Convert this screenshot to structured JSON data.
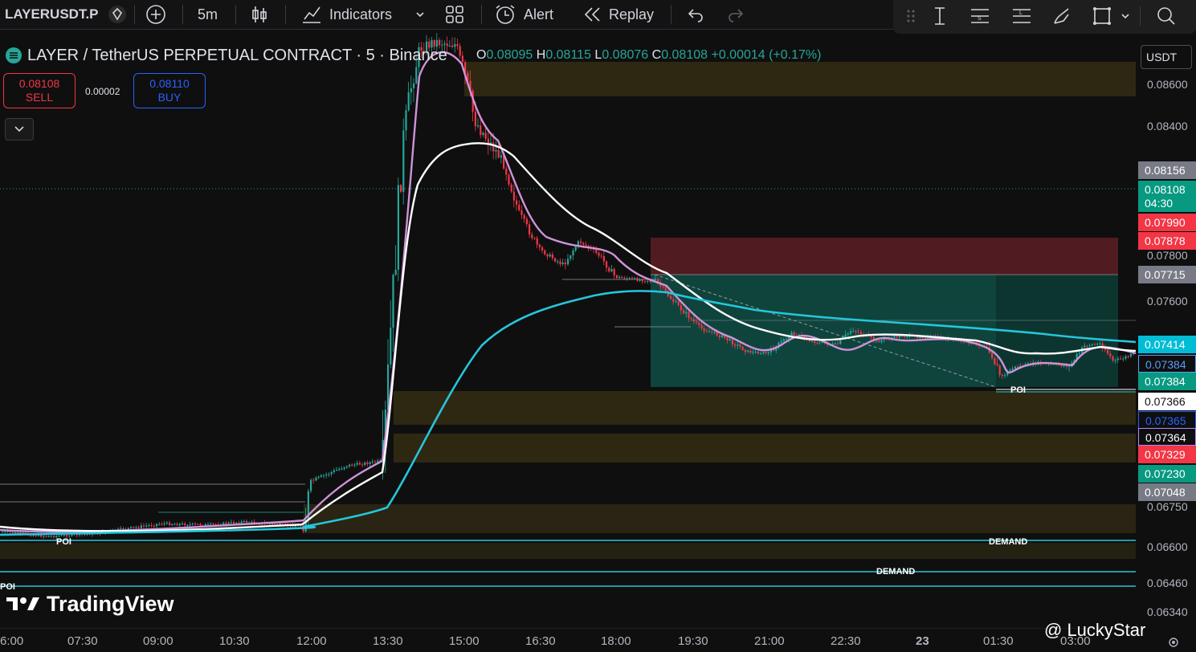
{
  "toolbar": {
    "symbol": "LAYERUSDT.P",
    "interval": "5m",
    "indicators_label": "Indicators",
    "alert_label": "Alert",
    "replay_label": "Replay"
  },
  "legend": {
    "title": "LAYER / TetherUS PERPETUAL CONTRACT · 5 · Binance",
    "open_label": "O",
    "open": "0.08095",
    "high_label": "H",
    "high": "0.08115",
    "low_label": "L",
    "low": "0.08076",
    "close_label": "C",
    "close": "0.08108",
    "change": "+0.00014 (+0.17%)"
  },
  "trade": {
    "sell_price": "0.08108",
    "sell_label": "SELL",
    "spread": "0.00002",
    "buy_price": "0.08110",
    "buy_label": "BUY"
  },
  "price_axis": {
    "currency": "USDT",
    "ticks": [
      "0.08600",
      "0.08400",
      "0.07800",
      "0.07600",
      "0.06750",
      "0.06600",
      "0.06460",
      "0.06340"
    ],
    "labels": [
      {
        "text": "0.08156",
        "bg": "#787b86"
      },
      {
        "text": "0.08108",
        "bg": "#089981"
      },
      {
        "text": "04:30",
        "bg": "#089981"
      },
      {
        "text": "0.07990",
        "bg": "#f23645"
      },
      {
        "text": "0.07878",
        "bg": "#f23645"
      },
      {
        "text": "0.07715",
        "bg": "#787b86"
      },
      {
        "text": "0.07414",
        "bg": "#00bcd4"
      },
      {
        "text": "0.07384",
        "bg": "#5b9cf6"
      },
      {
        "text": "0.07384",
        "bg": "#089981"
      },
      {
        "text": "0.07366",
        "bg": "#ffffff"
      },
      {
        "text": "0.07365",
        "bg": "#2962ff"
      },
      {
        "text": "0.07364",
        "bg": "#b388ff"
      },
      {
        "text": "0.07329",
        "bg": "#f23645"
      },
      {
        "text": "0.07230",
        "bg": "#089981"
      },
      {
        "text": "0.07048",
        "bg": "#787b86"
      }
    ]
  },
  "time_axis": {
    "ticks": [
      "6:00",
      "07:30",
      "09:00",
      "10:30",
      "12:00",
      "13:30",
      "15:00",
      "16:30",
      "18:00",
      "19:30",
      "21:00",
      "22:30",
      "23",
      "01:30",
      "03:00"
    ]
  },
  "chart": {
    "zone_labels": [
      "POI",
      "POI",
      "DEMAND",
      "DEMAND",
      "POI"
    ],
    "colors": {
      "up": "#26a69a",
      "down": "#f23645",
      "ema_fast": "#ce93d8",
      "ema_mid": "#ffffff",
      "ema_slow": "#26c6da",
      "zone": "#3a3216"
    }
  },
  "branding": {
    "logo_text": "TradingView",
    "watermark": "@ LuckyStar"
  }
}
